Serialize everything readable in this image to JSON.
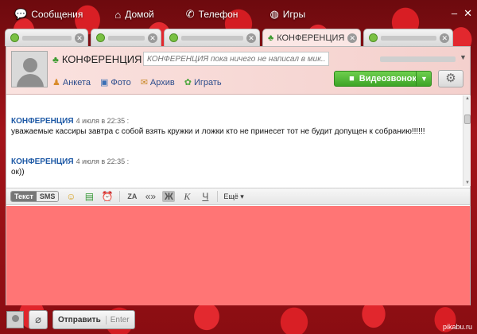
{
  "topbar": {
    "items": [
      {
        "label": "Сообщения",
        "icon": "chat-bubble-icon"
      },
      {
        "label": "Домой",
        "icon": "home-icon"
      },
      {
        "label": "Телефон",
        "icon": "phone-icon"
      },
      {
        "label": "Игры",
        "icon": "globe-icon"
      }
    ]
  },
  "tabs": {
    "active_label": "КОНФЕРЕНЦИЯ"
  },
  "header": {
    "title": "КОНФЕРЕНЦИЯ",
    "status_placeholder": "КОНФЕРЕНЦИЯ пока ничего не написал в мик...",
    "links": {
      "profile": "Анкета",
      "photo": "Фото",
      "archive": "Архив",
      "add": "Играть"
    },
    "video_call": "Видеозвонок"
  },
  "chat": {
    "messages": [
      {
        "author": "КОНФЕРЕНЦИЯ",
        "time": "4 июля в 22:35 :",
        "text": "уважаемые кассиры завтра с собой взять кружки и ложки кто не принесет тот не будит допущен к собранию!!!!!!"
      },
      {
        "author": "КОНФЕРЕНЦИЯ",
        "time": "4 июля в 22:35 :",
        "text": "ок))"
      }
    ]
  },
  "toolbar": {
    "mode_text": "Текст",
    "mode_sms": "SMS",
    "more": "Ещё"
  },
  "bottombar": {
    "send": "Отправить",
    "enter": "Enter"
  },
  "watermark": "pikabu.ru",
  "colors": {
    "input_area": "#ff7575",
    "video_button": "#4db533",
    "author_link": "#1f5aa6"
  }
}
